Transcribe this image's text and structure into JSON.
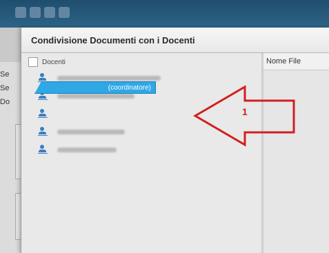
{
  "dialog": {
    "title": "Condivisione Documenti con i Docenti"
  },
  "tree": {
    "root_label": "Docenti",
    "root_checked": false,
    "items": [
      {
        "label": "",
        "blurred": true,
        "selected": false
      },
      {
        "label": "",
        "blurred": true,
        "selected": false
      },
      {
        "label": "(coordinatore)",
        "blurred": true,
        "selected": true
      },
      {
        "label": "",
        "blurred": true,
        "selected": false
      },
      {
        "label": "",
        "blurred": true,
        "selected": false
      }
    ]
  },
  "file_panel": {
    "column_header": "Nome File"
  },
  "background_sidebar": {
    "labels": [
      "Se",
      "Se",
      "Do"
    ]
  },
  "annotation": {
    "number": "1",
    "arrow_color": "#d21e1e"
  },
  "colors": {
    "selection": "#2fa8e6",
    "header_bar": "#1f4d6e",
    "user_icon": "#3a7fc1"
  },
  "icons": {
    "tree_item": "user-icon",
    "root": "checkbox"
  }
}
